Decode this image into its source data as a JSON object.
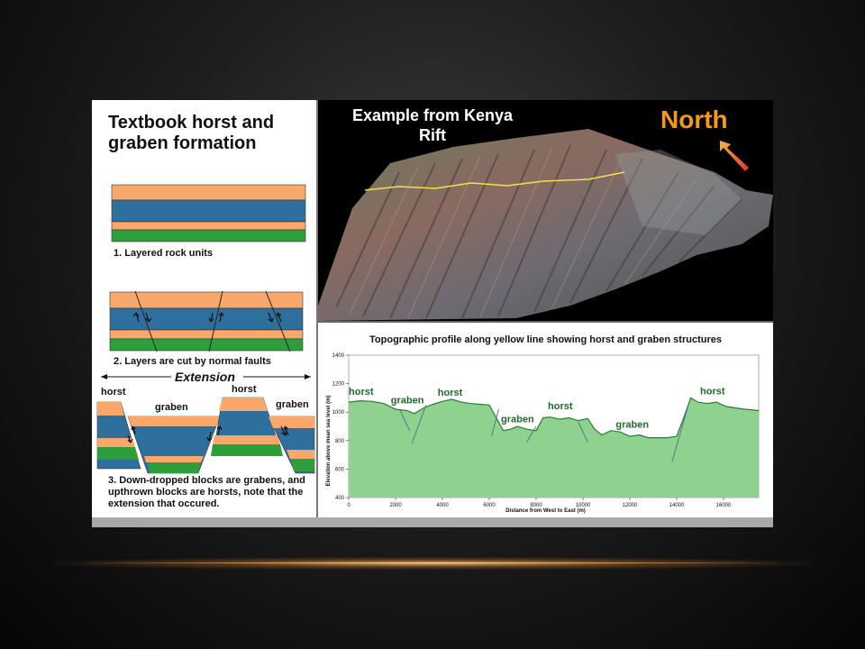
{
  "left_panel": {
    "title": "Textbook horst and graben formation",
    "captions": [
      "1. Layered rock units",
      "2. Layers are cut by normal faults",
      "3. Down-dropped blocks are grabens, and upthrown blocks are horsts, note that the extension that occured."
    ],
    "extension_label": "Extension",
    "block_labels": [
      "horst",
      "graben",
      "horst",
      "graben"
    ],
    "layer_colors": {
      "orange": "#f9a86b",
      "blue": "#2f6f9e",
      "green": "#2e9e3c"
    }
  },
  "photo_panel": {
    "title": "Example from Kenya Rift",
    "north_label": "North",
    "north_color": "#f39a1e"
  },
  "profile_panel": {
    "title": "Topographic profile along yellow line showing horst and graben structures",
    "labels": [
      "horst",
      "graben",
      "horst",
      "graben",
      "horst",
      "graben",
      "horst"
    ],
    "label_color": "#1f6b2a"
  },
  "chart_data": {
    "type": "area",
    "title": "Topographic profile along yellow line showing horst and graben structures",
    "xlabel": "Distance from West to East (m)",
    "ylabel": "Elevation above mean sea level (m)",
    "xlim": [
      0,
      17500
    ],
    "ylim": [
      400,
      1400
    ],
    "xticks": [
      0,
      2000,
      4000,
      6000,
      8000,
      10000,
      12000,
      14000,
      16000
    ],
    "yticks": [
      400,
      600,
      800,
      1000,
      1200,
      1400
    ],
    "x": [
      0,
      500,
      1000,
      1500,
      2000,
      2500,
      2800,
      3200,
      3600,
      4000,
      4400,
      4800,
      5200,
      5600,
      6000,
      6300,
      6600,
      6900,
      7200,
      7600,
      8000,
      8300,
      8600,
      9000,
      9400,
      9800,
      10200,
      10500,
      10800,
      11200,
      11600,
      12000,
      12400,
      12800,
      13200,
      13600,
      14000,
      14300,
      14600,
      14900,
      15300,
      15700,
      16100,
      16500,
      16900,
      17300,
      17500
    ],
    "y": [
      1070,
      1080,
      1075,
      1060,
      1020,
      1010,
      990,
      1030,
      1055,
      1075,
      1090,
      1070,
      1060,
      1055,
      1050,
      960,
      870,
      880,
      900,
      880,
      870,
      960,
      965,
      950,
      960,
      940,
      955,
      880,
      840,
      870,
      860,
      830,
      840,
      820,
      820,
      820,
      830,
      960,
      1100,
      1070,
      1060,
      1070,
      1040,
      1030,
      1020,
      1015,
      1010
    ],
    "annotations": [
      "horst",
      "graben",
      "horst",
      "graben",
      "horst",
      "graben",
      "horst"
    ],
    "fill_color": "#8fd18f",
    "line_color": "#2d7a36"
  }
}
